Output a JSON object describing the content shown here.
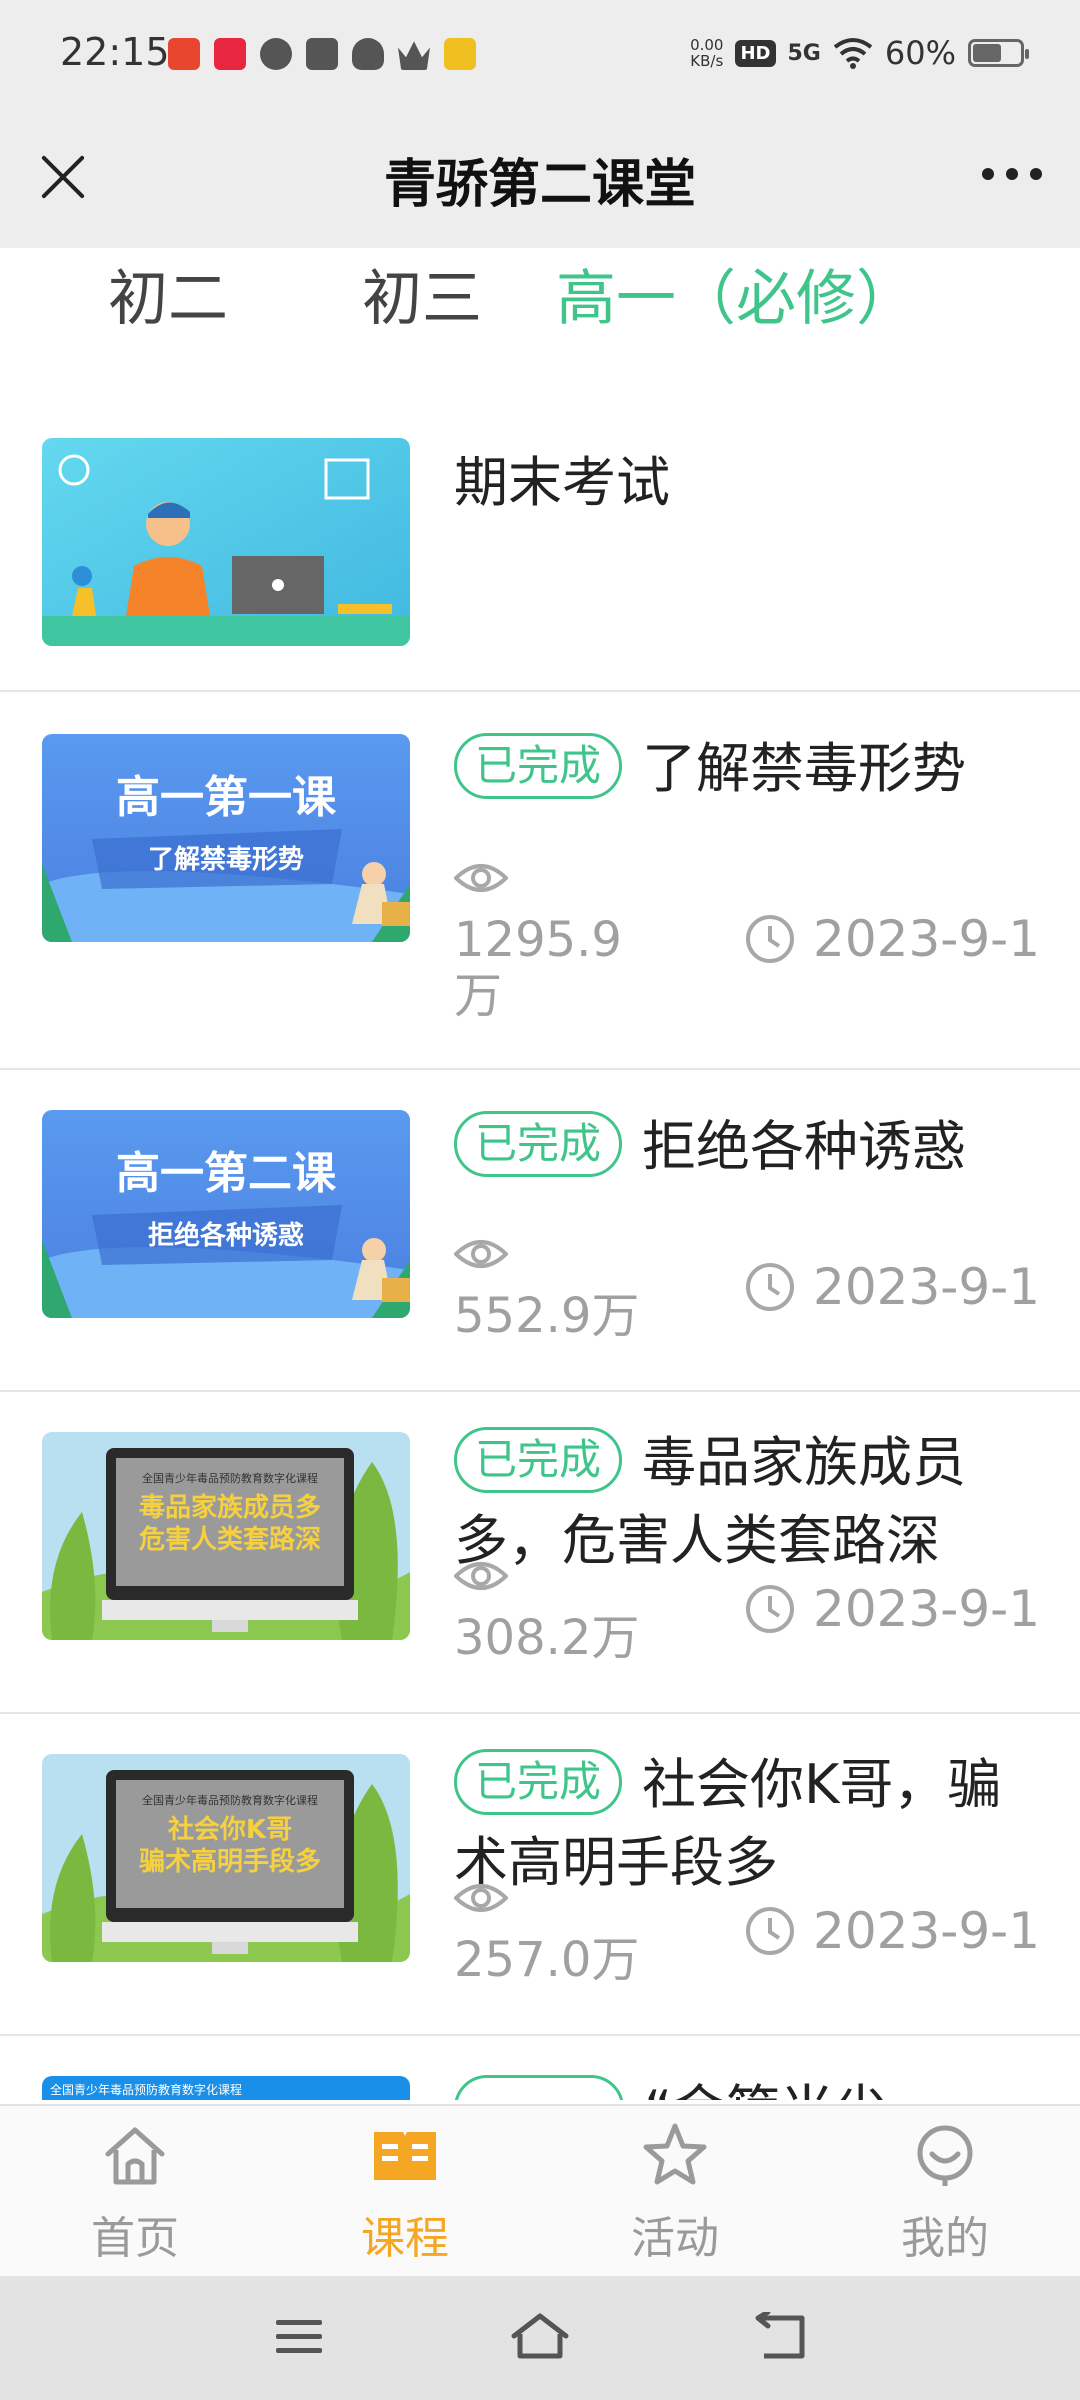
{
  "status_bar": {
    "time": "22:15",
    "net_speed_value": "0.00",
    "net_speed_unit": "KB/s",
    "hd_label": "HD",
    "signal_label": "5G",
    "battery_percent": "60%",
    "battery_level": 0.6
  },
  "header": {
    "title": "青骄第二课堂"
  },
  "tabs": [
    {
      "label": "初二",
      "active": false
    },
    {
      "label": "初三",
      "active": false
    },
    {
      "label": "高一（必修）",
      "active": true
    }
  ],
  "courses": [
    {
      "title": "期末考试",
      "badge": "",
      "views": "",
      "date": ""
    },
    {
      "title": "了解禁毒形势",
      "badge": "已完成",
      "views": "1295.9万",
      "date": "2023-9-1",
      "thumb_title": "高一第一课",
      "thumb_sub": "了解禁毒形势"
    },
    {
      "title": "拒绝各种诱惑",
      "badge": "已完成",
      "views": "552.9万",
      "date": "2023-9-1",
      "thumb_title": "高一第二课",
      "thumb_sub": "拒绝各种诱惑"
    },
    {
      "title": "毒品家族成员多，危害人类套路深",
      "badge": "已完成",
      "views": "308.2万",
      "date": "2023-9-1",
      "thumb_header": "全国青少年毒品预防教育数字化课程",
      "thumb_line1": "毒品家族成员多",
      "thumb_line2": "危害人类套路深"
    },
    {
      "title": "社会你K哥，骗术高明手段多",
      "badge": "已完成",
      "views": "257.0万",
      "date": "2023-9-1",
      "thumb_header": "全国青少年毒品预防教育数字化课程",
      "thumb_line1": "社会你K哥",
      "thumb_line2": "骗术高明手段多"
    },
    {
      "title": "“金箍当尖",
      "badge": "",
      "views": "",
      "date": "",
      "thumb_header": "全国青少年毒品预防教育数字化课程"
    }
  ],
  "bottom_nav": [
    {
      "label": "首页",
      "icon": "home-icon",
      "active": false
    },
    {
      "label": "课程",
      "icon": "book-icon",
      "active": true
    },
    {
      "label": "活动",
      "icon": "star-icon",
      "active": false
    },
    {
      "label": "我的",
      "icon": "smile-icon",
      "active": false
    }
  ],
  "colors": {
    "accent_green": "#3fc58a",
    "nav_active": "#f5a623",
    "muted_text": "#a0a0a0"
  }
}
